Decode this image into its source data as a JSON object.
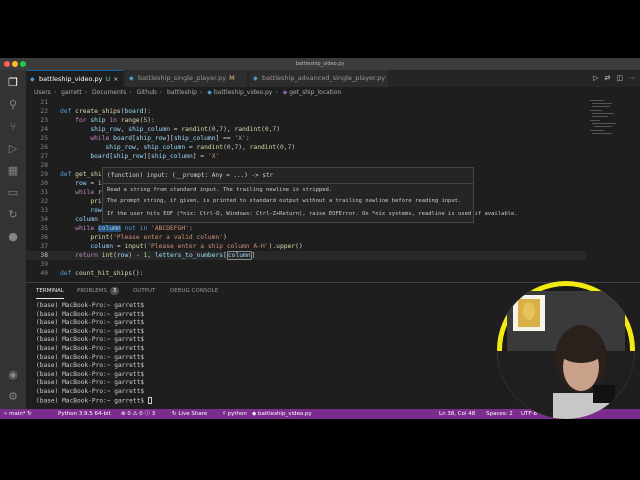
{
  "window": {
    "title": "battleship_video.py"
  },
  "tabs": [
    {
      "label": "battleship_video.py",
      "marker": "U",
      "active": true
    },
    {
      "label": "battleship_single_player.py",
      "marker": "M",
      "active": false
    },
    {
      "label": "battleship_advanced_single_player.py",
      "marker": "",
      "active": false
    }
  ],
  "breadcrumbs": [
    "Users",
    "garrett",
    "Documents",
    "Github",
    "battleship",
    "battleship_video.py",
    "get_ship_location"
  ],
  "editor": {
    "lines": [
      {
        "num": "21",
        "text": ""
      },
      {
        "num": "22",
        "text": "def create_ships(board):"
      },
      {
        "num": "23",
        "text": "    for ship in range(5):"
      },
      {
        "num": "24",
        "text": "        ship_row, ship_column = randint(0,7), randint(0,7)"
      },
      {
        "num": "25",
        "text": "        while board[ship_row][ship_column] == 'X':"
      },
      {
        "num": "26",
        "text": "            ship_row, ship_column = randint(0,7), randint(0,7)"
      },
      {
        "num": "27",
        "text": "        board[ship_row][ship_column] = 'X'"
      },
      {
        "num": "28",
        "text": ""
      },
      {
        "num": "29",
        "text": "def get_shi"
      },
      {
        "num": "30",
        "text": "    row = inp"
      },
      {
        "num": "31",
        "text": "    while row"
      },
      {
        "num": "32",
        "text": "        print("
      },
      {
        "num": "33",
        "text": "        row = i"
      },
      {
        "num": "34",
        "text": "    column = input('Please enter a ship column A-H').upper()"
      },
      {
        "num": "35",
        "text": "    while column not in 'ABCDEFGH':"
      },
      {
        "num": "36",
        "text": "        print('Please enter a valid column')"
      },
      {
        "num": "37",
        "text": "        column = input('Please enter a ship column A-H').upper()"
      },
      {
        "num": "38",
        "text": "    return int(row) - 1, letters_to_numbers[column]"
      },
      {
        "num": "39",
        "text": ""
      },
      {
        "num": "40",
        "text": "def count_hit_ships():"
      }
    ],
    "current_line": "38"
  },
  "hover": {
    "signature": "(function) input: (__prompt: Any = ...) -> str",
    "desc1": "Read a string from standard input. The trailing newline is stripped.",
    "desc2": "The prompt string, if given, is printed to standard output without a trailing newline before reading input.",
    "desc3": "If the user hits EOF (*nix: Ctrl-D, Windows: Ctrl-Z+Return), raise EOFError. On *nix systems, readline is used if available."
  },
  "panel": {
    "tabs": [
      {
        "label": "TERMINAL",
        "active": true
      },
      {
        "label": "PROBLEMS",
        "badge": "3",
        "active": false
      },
      {
        "label": "OUTPUT",
        "active": false
      },
      {
        "label": "DEBUG CONSOLE",
        "active": false
      }
    ],
    "terminal_lines": [
      "(base) MacBook-Pro:~ garrett$",
      "(base) MacBook-Pro:~ garrett$",
      "(base) MacBook-Pro:~ garrett$",
      "(base) MacBook-Pro:~ garrett$",
      "(base) MacBook-Pro:~ garrett$",
      "(base) MacBook-Pro:~ garrett$",
      "(base) MacBook-Pro:~ garrett$",
      "(base) MacBook-Pro:~ garrett$",
      "(base) MacBook-Pro:~ garrett$",
      "(base) MacBook-Pro:~ garrett$",
      "(base) MacBook-Pro:~ garrett$",
      "(base) MacBook-Pro:~ garrett$"
    ]
  },
  "statusbar": {
    "branch": "main*",
    "interpreter": "Python 3.9.5 64-bit",
    "errors": "0",
    "warnings": "0",
    "info": "3",
    "live_share": "Live Share",
    "language_mode": "python",
    "file": "battleship_video.py",
    "position": "Ln 38, Col 48",
    "spaces": "Spaces: 2",
    "encoding": "UTF-8"
  },
  "colors": {
    "statusbar": "#7b2d8e",
    "editor_bg": "#1e1e1e",
    "webcam_bg": "#f3ea11"
  }
}
